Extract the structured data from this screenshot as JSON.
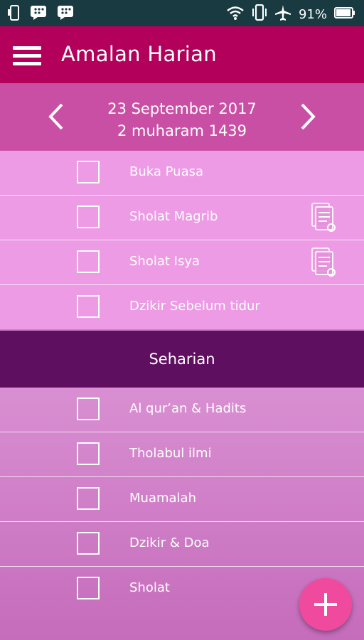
{
  "status_bar": {
    "battery_text": "91%",
    "icons": [
      "phone-icon",
      "bbm-icon",
      "bbm-icon",
      "wifi-icon",
      "vibrate-icon",
      "airplane-icon",
      "battery-icon"
    ]
  },
  "app_bar": {
    "title": "Amalan Harian",
    "menu_icon": "hamburger-menu-icon"
  },
  "date_nav": {
    "gregorian": "23 September 2017",
    "hijri": "2 muharam 1439",
    "prev_icon": "chevron-left-icon",
    "next_icon": "chevron-right-icon"
  },
  "evening_items": [
    {
      "label": "Buka Puasa",
      "checked": false
    },
    {
      "label": "Sholat Magrib",
      "checked": false,
      "icon": "note-icon"
    },
    {
      "label": "Sholat Isya",
      "checked": false,
      "icon": "note-icon"
    },
    {
      "label": "Dzikir Sebelum tidur",
      "checked": false
    }
  ],
  "section": {
    "title": "Seharian"
  },
  "daily_items": [
    {
      "label": "Al qur’an & Hadits",
      "checked": false
    },
    {
      "label": "Tholabul ilmi",
      "checked": false
    },
    {
      "label": "Muamalah",
      "checked": false
    },
    {
      "label": "Dzikir & Doa",
      "checked": false
    },
    {
      "label": "Sholat",
      "checked": false
    }
  ],
  "fab": {
    "icon": "plus-icon"
  },
  "colors": {
    "status_bar": "#183a40",
    "app_bar": "#b3005a",
    "date_bar": "#c94fa5",
    "section_header": "#5e0f5f",
    "fab": "#f04a9e"
  }
}
